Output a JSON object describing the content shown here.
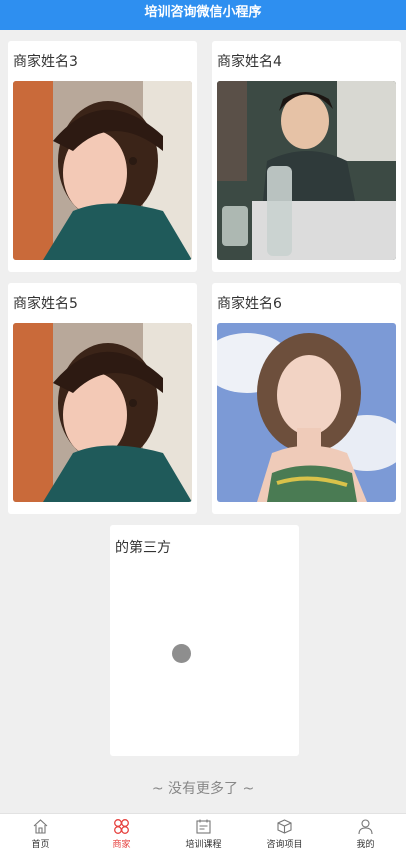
{
  "header": {
    "title": "培训咨询微信小程序"
  },
  "merchants": [
    {
      "name": "商家姓名3"
    },
    {
      "name": "商家姓名4"
    },
    {
      "name": "商家姓名5"
    },
    {
      "name": "商家姓名6"
    },
    {
      "name": "的第三方"
    }
  ],
  "footer_note": "~ 没有更多了 ~",
  "tabbar": {
    "tabs": [
      {
        "label": "首页",
        "icon": "home-icon"
      },
      {
        "label": "商家",
        "icon": "merchant-icon",
        "active": true
      },
      {
        "label": "培训课程",
        "icon": "calendar-icon"
      },
      {
        "label": "咨询项目",
        "icon": "box-icon"
      },
      {
        "label": "我的",
        "icon": "user-icon"
      }
    ]
  },
  "colors": {
    "header": "#2e8ff0",
    "active_tab": "#e64340",
    "background": "#efefef"
  }
}
